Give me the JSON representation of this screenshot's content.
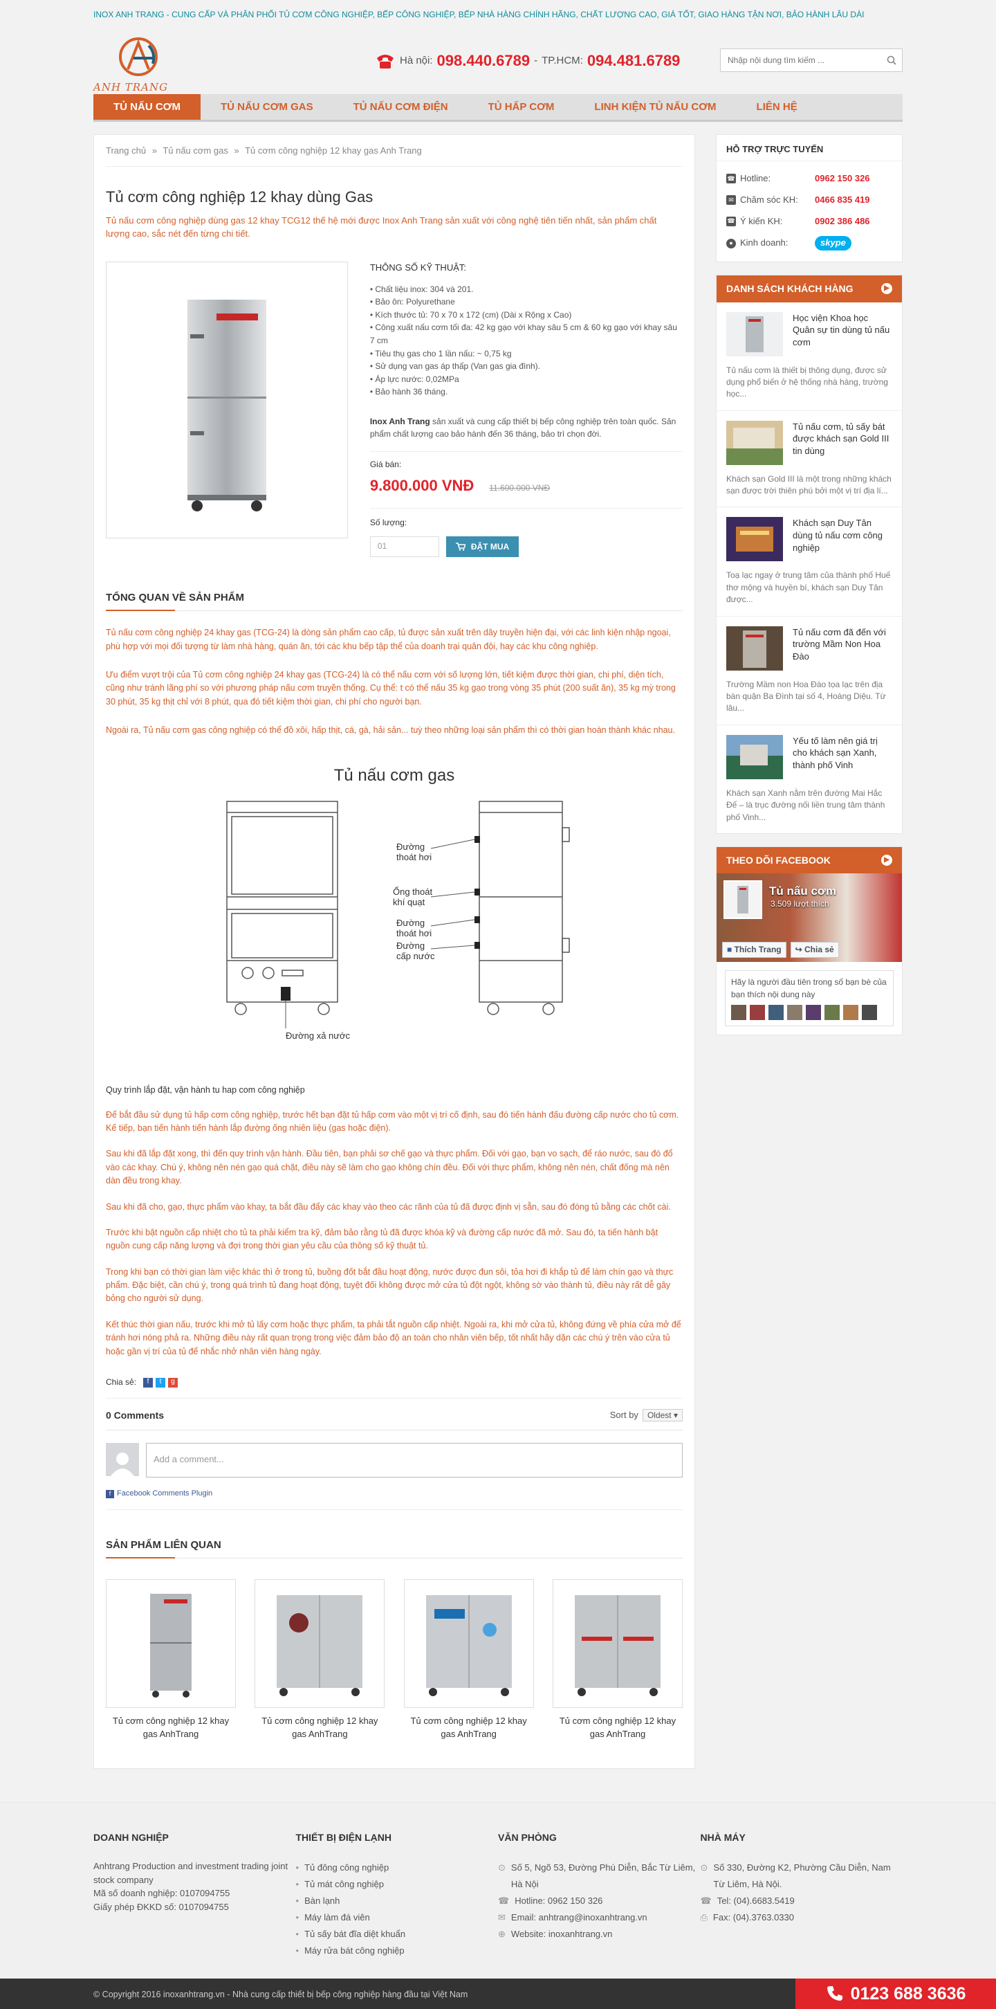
{
  "topbar": {
    "text": "INOX ANH TRANG - CUNG CẤP VÀ PHÂN PHỐI TỦ CƠM CÔNG NGHIỆP, BẾP CÔNG NGHIỆP, BẾP NHÀ HÀNG CHÍNH HÃNG, CHẤT LƯỢNG CAO, GIÁ TỐT, GIAO HÀNG TẬN NƠI, BẢO HÀNH LÂU DÀI"
  },
  "header": {
    "logo_text": "ANH TRANG",
    "hanoi_label": "Hà nội:",
    "hanoi_phone": "098.440.6789",
    "dash": "-",
    "hcm_label": "TP.HCM:",
    "hcm_phone": "094.481.6789",
    "search_placeholder": "Nhập nội dung tìm kiếm ..."
  },
  "nav": [
    {
      "label": "TỦ NẤU CƠM"
    },
    {
      "label": "TỦ NẤU CƠM GAS"
    },
    {
      "label": "TỦ NẤU CƠM ĐIỆN"
    },
    {
      "label": "TỦ HẤP CƠM"
    },
    {
      "label": "LINH KIỆN TỦ NẤU CƠM"
    },
    {
      "label": "LIÊN HỆ"
    }
  ],
  "breadcrumb": [
    "Trang chủ",
    "Tủ nấu cơm gas",
    "Tủ cơm công nghiệp 12 khay gas Anh Trang"
  ],
  "breadcrumb_sep": "»",
  "product": {
    "title": "Tủ cơm công nghiệp 12 khay dùng Gas",
    "summary": "Tủ nấu cơm công nghiệp dùng gas 12 khay TCG12 thế hệ mới được Inox Anh Trang sản xuất với công nghệ tiên tiến nhất, sản phẩm chất lượng cao, sắc nét đến từng chi tiết.",
    "specs_title": "THÔNG SỐ KỸ THUẬT:",
    "specs": [
      "• Chất liệu inox: 304 và 201.",
      "• Bảo ôn: Polyurethane",
      "• Kích thước tủ: 70 x 70 x 172 (cm) (Dài x Rộng x Cao)",
      "• Công xuất nấu cơm tối đa: 42 kg gạo với khay sâu 5 cm & 60 kg gạo với khay sâu 7 cm",
      "• Tiêu thụ gas cho 1 lần nấu: ~ 0,75 kg",
      "• Sử dụng van gas áp thấp (Van gas gia đình).",
      "• Áp lực nước: 0,02MPa",
      "• Bảo hành 36 tháng."
    ],
    "intro_brand": "Inox Anh Trang",
    "intro_rest": " sản xuất và cung cấp thiết bị bếp công nghiệp trên toàn quốc. Sản phẩm chất lượng cao bảo hành đến 36 tháng, bảo trì chọn đời.",
    "price_label": "Giá bán:",
    "price": "9.800.000 VNĐ",
    "old_price": "11.600.000 VNĐ",
    "qty_label": "Số lượng:",
    "qty_value": "01",
    "buy_label": "ĐẶT MUA"
  },
  "overview": {
    "title": "TỔNG QUAN VỀ SẢN PHẨM",
    "paragraphs": [
      "Tủ nấu cơm công nghiệp 24 khay gas (TCG-24) là dòng sản phẩm cao cấp, tủ được sản xuất trên dây truyền hiện đại, với các linh kiện nhập ngoại, phù hợp với mọi đối tượng từ làm nhà hàng, quán ăn, tới các khu bếp tập thể của doanh trại quân đội, hay các khu công nghiệp.",
      "Ưu điểm vượt trội của Tủ cơm công nghiệp 24 khay gas (TCG-24) là có thể nấu cơm với số lượng lớn, tiết kiệm được thời gian, chi phí, diện tích, cũng như tránh lãng phí so với phương pháp nấu cơm truyền thống. Cụ thể: t có thể nấu 35 kg gạo trong vòng 35 phút (200 suất ăn), 35 kg mỳ trong 30 phút, 35 kg thịt chỉ với 8 phút, qua đó tiết kiệm thời gian, chi phí cho người bạn.",
      "Ngoài ra, Tủ nấu cơm gas công nghiệp có thể đồ xôi, hấp thịt, cá, gà, hải sản... tuỳ theo những loại sản phẩm thì có thời gian hoàn thành khác nhau."
    ]
  },
  "diagram": {
    "title": "Tủ nấu cơm gas",
    "labels": {
      "steam1": [
        "Đường",
        "thoát hơi"
      ],
      "wind": [
        "Ống thoát",
        "khí quạt"
      ],
      "steam2": [
        "Đường",
        "thoát hơi"
      ],
      "water_in": [
        "Đường",
        "cấp nước"
      ],
      "drain": "Đường xả nước"
    }
  },
  "procedure": {
    "title": "Quy trình lắp đặt, vận hành tu hap com công nghiệp",
    "paragraphs": [
      "Để bắt đầu sử dụng tủ hấp cơm công nghiệp, trước hết bạn đặt tủ hấp cơm vào một vị trí cố định, sau đó tiến hành đấu đường cấp nước cho tủ cơm. Kế tiếp, bạn tiến hành tiến hành lắp đường ống nhiên liệu (gas hoặc điện).",
      "Sau khi đã lắp đặt xong, thì đến quy trình vận hành. Đầu tiên, bạn phải sơ chế gạo và thực phẩm. Đối với gạo, bạn vo sạch, để ráo nước, sau đó đổ vào các khay. Chú ý, không nên nén gạo quá chặt, điều này sẽ làm cho gạo không chín đều. Đối với thực phẩm, không nên nén, chất đống mà nên dàn đều trong khay.",
      "Sau khi đã cho, gạo, thực phẩm vào khay, ta bắt đầu đẩy các khay vào theo các rãnh của tủ đã được định vị sẵn, sau đó đóng tủ bằng các chốt cài.",
      "Trước khi bật nguồn cấp nhiệt cho tủ ta phải kiểm tra kỹ, đảm bảo rằng tủ đã được khóa kỹ và đường cấp nước đã mở. Sau đó, ta tiến hành bật nguồn cung cấp năng lượng và đợi trong thời gian yêu cầu của thông số kỹ thuật tủ.",
      "Trong khi bạn có thời gian làm việc khác thì ở trong tủ, buồng đốt bắt đầu hoạt động, nước được đun sôi, tỏa hơi đi khắp tủ để làm chín gạo và thực phẩm. Đặc biệt, cần chú ý, trong quá trình tủ đang hoạt động, tuyệt đối không được mở cửa tủ đột ngột, không sờ vào thành tủ, điều này rất dễ gây bỏng cho người sử dụng.",
      "Kết thúc thời gian nấu, trước khi mở tủ lấy cơm hoặc thực phẩm, ta phải tắt nguồn cấp nhiệt. Ngoài ra, khi mở cửa tủ, không đứng về phía cửa mở để tránh hơi nóng phả ra. Những điều này rất quan trọng trong việc đảm bảo độ an toàn cho nhân viên bếp, tốt nhất hãy dặn các chú ý trên vào cửa tủ hoặc gần vị trí của tủ để nhắc nhở nhân viên hàng ngày."
    ]
  },
  "share": {
    "label": "Chia sẻ:"
  },
  "comments": {
    "count": "0 Comments",
    "sort_label": "Sort by",
    "sort_value": "Oldest",
    "placeholder": "Add a comment...",
    "plugin": "Facebook Comments Plugin"
  },
  "related": {
    "title": "SẢN PHẨM LIÊN QUAN",
    "items": [
      {
        "name": "Tủ cơm công nghiệp 12 khay gas AnhTrang"
      },
      {
        "name": "Tủ cơm công nghiệp 12 khay gas AnhTrang"
      },
      {
        "name": "Tủ cơm công nghiệp 12 khay gas AnhTrang"
      },
      {
        "name": "Tủ cơm công nghiệp 12 khay gas AnhTrang"
      }
    ]
  },
  "sidebar": {
    "support_title": "HỖ TRỢ TRỰC TUYẾN",
    "support": [
      {
        "label": "Hotline:",
        "value": "0962 150 326"
      },
      {
        "label": "Chăm sóc KH:",
        "value": "0466 835 419"
      },
      {
        "label": "Ý kiến KH:",
        "value": "0902 386 486"
      }
    ],
    "business_label": "Kinh doanh:",
    "skype_label": "skype",
    "customers_title": "DANH SÁCH KHÁCH HÀNG",
    "customers": [
      {
        "title": "Học viện Khoa học Quân sự tin dùng tủ nấu cơm",
        "desc": "Tủ nấu cơm là thiết bị thông dụng, được sử dụng phổ biến ở hệ thống nhà hàng, trường học...",
        "colors": [
          "#e8ecef",
          "#a9b4bd"
        ]
      },
      {
        "title": "Tủ nấu cơm, tủ sấy bát được khách sạn Gold III tin dùng",
        "desc": "Khách sạn Gold III là một trong những khách sạn được trời thiên phú bởi một vị trí địa lí...",
        "colors": [
          "#6f8c4f",
          "#d9c39a"
        ]
      },
      {
        "title": "Khách sạn Duy Tân dùng tủ nấu cơm công nghiệp",
        "desc": "Toạ lạc ngay ở trung tâm của thành phố Huế thơ mộng và huyền bí, khách sạn Duy Tân được...",
        "colors": [
          "#3a2a5e",
          "#c77b3a"
        ]
      },
      {
        "title": "Tủ nấu cơm đã đến với trường Mầm Non Hoa Đào",
        "desc": "Trường Mầm non Hoa Đào tọa lạc trên địa bàn quận Ba Đình tại số 4, Hoàng Diệu. Từ lâu...",
        "colors": [
          "#5b4a3a",
          "#b9b2a8"
        ]
      },
      {
        "title": "Yếu tố làm nên giá trị cho khách sạn Xanh, thành phố Vinh",
        "desc": "Khách sạn Xanh nằm trên đường Mai Hắc Đế – là trục đường nối liền trung tâm thành phố Vinh...",
        "colors": [
          "#2f6a4a",
          "#7aa4c9"
        ]
      }
    ],
    "facebook_title": "THEO DÕI FACEBOOK",
    "fb_name": "Tủ nấu cơm",
    "fb_likes": "3.509 lượt thích",
    "fb_like": "Thích Trang",
    "fb_share": "Chia sẻ",
    "fb_friends": "Hãy là người đầu tiên trong số bạn bè của bạn thích nội dung này"
  },
  "footer": {
    "col1": {
      "title": "DOANH NGHIỆP",
      "lines": [
        "Anhtrang Production and investment trading joint stock company",
        "Mã số doanh nghiệp: 0107094755",
        "Giấy phép ĐKKD số: 0107094755"
      ]
    },
    "col2": {
      "title": "THIẾT BỊ ĐIỆN LẠNH",
      "items": [
        "Tủ đông công nghiệp",
        "Tủ mát công nghiệp",
        "Bàn lạnh",
        "Máy làm đá viên",
        "Tủ sấy bát đĩa diệt khuẩn",
        "Máy rửa bát công nghiệp"
      ]
    },
    "col3": {
      "title": "VĂN PHÒNG",
      "items": [
        "Số 5, Ngõ 53, Đường Phú Diễn, Bắc Từ Liêm, Hà Nội",
        "Hotline: 0962 150 326",
        "Email: anhtrang@inoxanhtrang.vn",
        "Website: inoxanhtrang.vn"
      ]
    },
    "col4": {
      "title": "NHÀ MÁY",
      "items": [
        "Số 330, Đường K2, Phường Cầu Diễn, Nam Từ Liêm, Hà Nội.",
        "Tel: (04).6683.5419",
        "Fax: (04).3763.0330"
      ]
    },
    "copyright": "© Copyright 2016 inoxanhtrang.vn - Nhà cung cấp thiết bị bếp công nghiệp hàng đầu tại Việt Nam",
    "hotline": "0123 688 3636"
  }
}
